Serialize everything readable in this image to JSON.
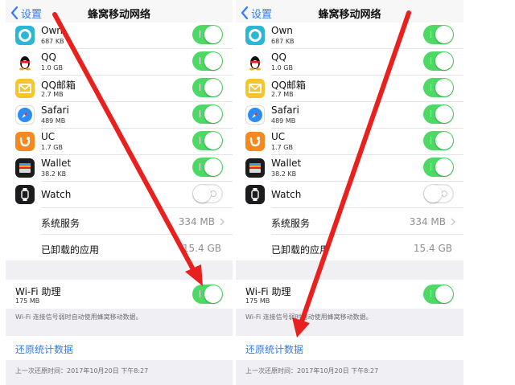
{
  "colors": {
    "accent": "#2f7cf6",
    "switch_on": "#4cd964",
    "arrow": "#e8201e"
  },
  "nav": {
    "back_label": "设置",
    "title": "蜂窝移动网络"
  },
  "apps": [
    {
      "name": "Own",
      "size": "687 KB",
      "icon": "own-app-icon",
      "enabled": true
    },
    {
      "name": "QQ",
      "size": "1.0 GB",
      "icon": "qq-penguin-icon",
      "enabled": true
    },
    {
      "name": "QQ邮箱",
      "size": "2.7 MB",
      "icon": "qq-mail-icon",
      "enabled": true
    },
    {
      "name": "Safari",
      "size": "489 MB",
      "icon": "safari-compass-icon",
      "enabled": true
    },
    {
      "name": "UC",
      "size": "1.7 GB",
      "icon": "uc-browser-icon",
      "enabled": true
    },
    {
      "name": "Wallet",
      "size": "38.2 KB",
      "icon": "wallet-icon",
      "enabled": true
    },
    {
      "name": "Watch",
      "size": "",
      "icon": "watch-icon",
      "enabled": false
    }
  ],
  "system_services": {
    "label": "系统服务",
    "value": "334 MB"
  },
  "uninstalled_apps": {
    "label": "已卸载的应用",
    "value": "15.4 GB"
  },
  "wifi_assist": {
    "label": "Wi-Fi 助理",
    "size": "175 MB",
    "enabled": true,
    "footnote": "Wi-Fi 连接信号弱时自动使用蜂窝移动数据。"
  },
  "reset": {
    "label": "还原统计数据",
    "last_reset": "上一次还原时间：2017年10月20日 下午8:27"
  }
}
